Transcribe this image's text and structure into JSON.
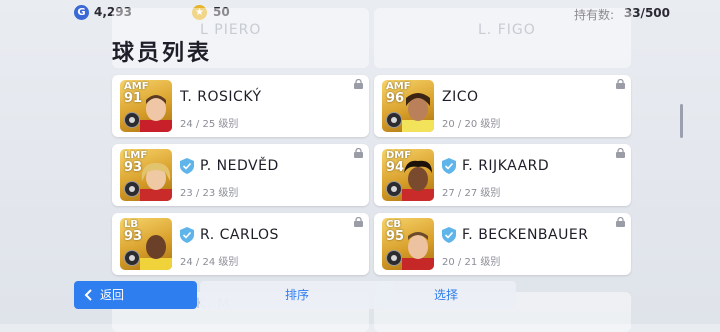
{
  "currency": {
    "gp": "4,293",
    "coins": "50",
    "gp_icon": "G",
    "coin_icon": "★"
  },
  "owned": {
    "label": "持有数:",
    "value": "33/500"
  },
  "title": "球员列表",
  "ghost_top": {
    "left": "L PIERO",
    "right": "L. FIGO"
  },
  "ghost_bottom": {
    "left": "K. M"
  },
  "players": [
    {
      "pos": "AMF",
      "rating": "91",
      "name": "T. ROSICKÝ",
      "level": "24 / 25 级别",
      "shield": false
    },
    {
      "pos": "AMF",
      "rating": "96",
      "name": "ZICO",
      "level": "20 / 20 级别",
      "shield": false
    },
    {
      "pos": "LMF",
      "rating": "93",
      "name": "P. NEDVĚD",
      "level": "23 / 23 级别",
      "shield": true
    },
    {
      "pos": "DMF",
      "rating": "94",
      "name": "F. RIJKAARD",
      "level": "27 / 27 级别",
      "shield": true
    },
    {
      "pos": "LB",
      "rating": "93",
      "name": "R. CARLOS",
      "level": "24 / 24 级别",
      "shield": true
    },
    {
      "pos": "CB",
      "rating": "95",
      "name": "F. BECKENBAUER",
      "level": "20 / 21 级别",
      "shield": true
    }
  ],
  "buttons": {
    "back": "返回",
    "sort": "排序",
    "select": "选择"
  },
  "colors": {
    "accent": "#2f7ef0",
    "shield": "#5fb4ea",
    "card_gold": "#d9a02b"
  }
}
